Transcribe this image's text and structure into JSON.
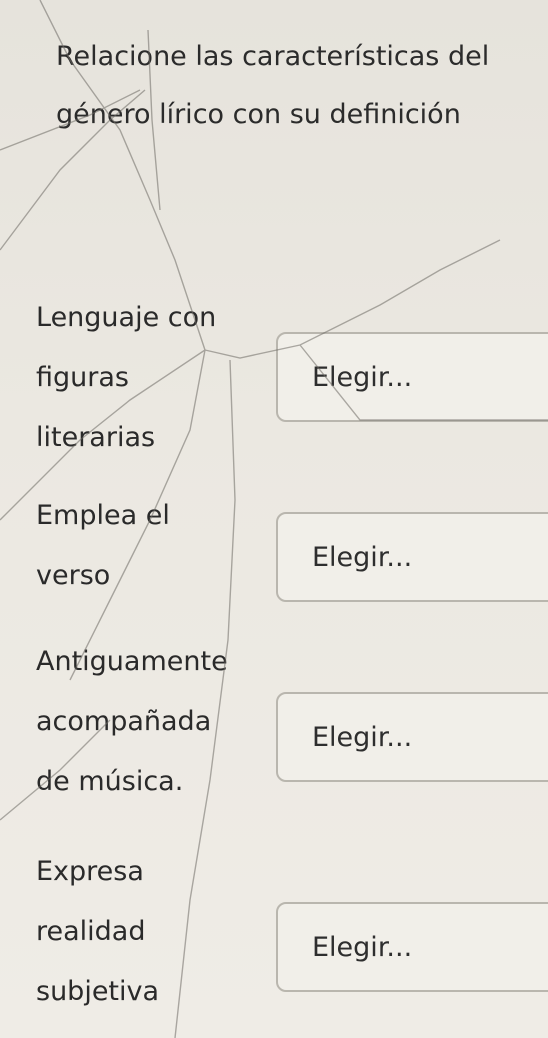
{
  "question": {
    "title": "Relacione las características del género lírico con su definición"
  },
  "rows": [
    {
      "label_lines": [
        "Lenguaje con",
        "figuras",
        "literarias"
      ],
      "select_value": "Elegir..."
    },
    {
      "label_lines": [
        "Emplea el",
        "verso"
      ],
      "select_value": "Elegir..."
    },
    {
      "label_lines": [
        "Antiguamente",
        "acompañada",
        "de música."
      ],
      "select_value": "Elegir..."
    },
    {
      "label_lines": [
        "Expresa",
        "realidad",
        "subjetiva"
      ],
      "select_value": "Elegir..."
    }
  ]
}
